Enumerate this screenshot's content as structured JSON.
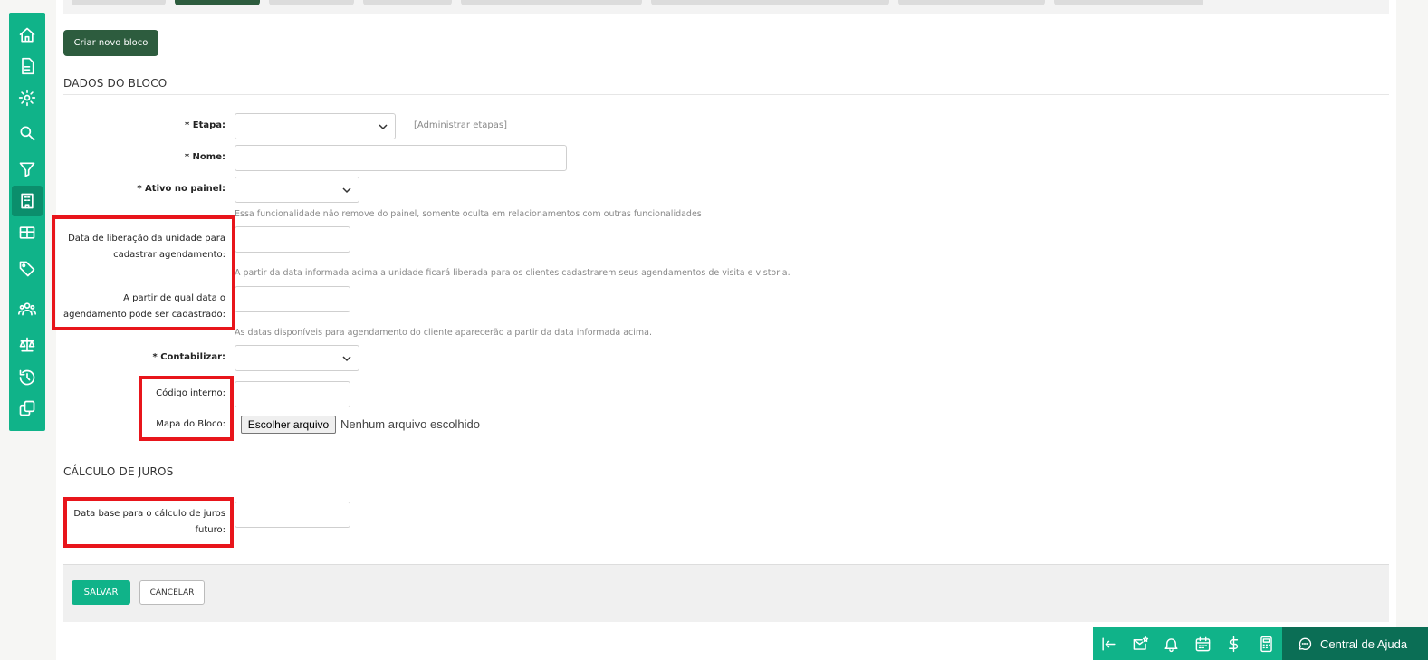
{
  "toolbar": {
    "new_block_label": "Criar novo bloco"
  },
  "sections": {
    "block_data_title": "DADOS DO BLOCO",
    "interest_title": "CÁLCULO DE JUROS"
  },
  "form": {
    "etapa": {
      "required": "* ",
      "label": "Etapa:",
      "value": "",
      "admin_link": "[Administrar etapas]"
    },
    "nome": {
      "required": "* ",
      "label": "Nome:",
      "value": ""
    },
    "ativo_painel": {
      "required": "* ",
      "label": "Ativo no painel:",
      "value": "",
      "hint": "Essa funcionalidade não remove do painel, somente oculta em relacionamentos com outras funcionalidades"
    },
    "data_liberacao": {
      "label_line1": "Data de liberação da unidade para",
      "label_line2": "cadastrar agendamento:",
      "value": "",
      "hint": "A partir da data informada acima a unidade ficará liberada para os clientes cadastrarem seus agendamentos de visita e vistoria."
    },
    "data_agendamento": {
      "label_line1": "A partir de qual data o",
      "label_line2": "agendamento pode ser cadastrado:",
      "value": "",
      "hint": "As datas disponíveis para agendamento do cliente aparecerão a partir da data informada acima."
    },
    "contabilizar": {
      "required": "* ",
      "label": "Contabilizar:",
      "value": ""
    },
    "codigo_interno": {
      "label": "Código interno:",
      "value": ""
    },
    "mapa_bloco": {
      "label": "Mapa do Bloco:",
      "button": "Escolher arquivo",
      "status": "Nenhum arquivo escolhido"
    },
    "data_base_juros": {
      "label_line1": "Data base para o cálculo de juros",
      "label_line2": "futuro:",
      "value": ""
    }
  },
  "actions": {
    "save": "SALVAR",
    "cancel": "CANCELAR"
  },
  "help": {
    "label": "Central de Ajuda"
  },
  "colors": {
    "brand_green": "#10b389",
    "dark_green": "#2d5c3e",
    "highlight_red": "#e8151b"
  },
  "sidebar_icons": [
    "home-icon",
    "document-icon",
    "gear-icon",
    "search-icon",
    "filter-icon",
    "building-icon",
    "table-icon",
    "tag-icon",
    "users-icon",
    "scale-icon",
    "history-icon",
    "copy-icon"
  ],
  "bottom_tool_icons": [
    "collapse-left-icon",
    "mail-star-icon",
    "bell-icon",
    "calendar-icon",
    "dollar-icon",
    "calculator-icon"
  ]
}
